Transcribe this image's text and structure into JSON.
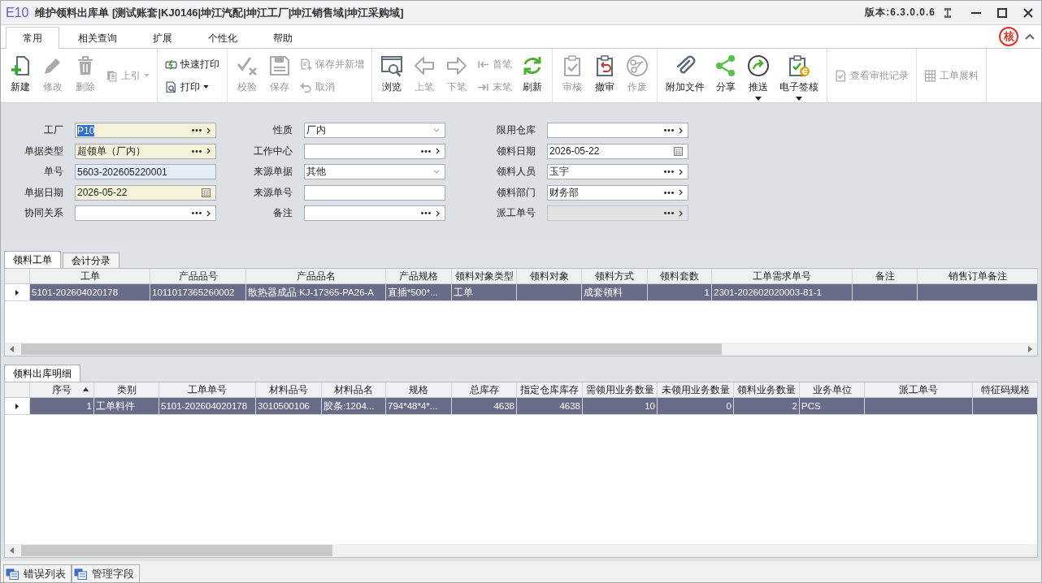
{
  "window": {
    "logo": "E10",
    "title": "维护领料出库单 [测试账套|KJ0146|坤江汽配|坤江工厂|坤江销售域|坤江采购域]",
    "version": "版本:6.3.0.0.6"
  },
  "ribbon_tabs": [
    {
      "label": "常用",
      "selected": true
    },
    {
      "label": "相关查询",
      "selected": false
    },
    {
      "label": "扩展",
      "selected": false
    },
    {
      "label": "个性化",
      "selected": false
    },
    {
      "label": "帮助",
      "selected": false
    }
  ],
  "stamp": "核",
  "toolbar": {
    "groups": [
      {
        "items": [
          {
            "kind": "large",
            "label": "新建",
            "disabled": false,
            "dropdown": false
          },
          {
            "kind": "large",
            "label": "修改",
            "disabled": true,
            "dropdown": false
          },
          {
            "kind": "large",
            "label": "删除",
            "disabled": true,
            "dropdown": false
          },
          {
            "kind": "inline",
            "label": "上引",
            "disabled": true,
            "dropdown": true
          }
        ]
      },
      {
        "items": [
          {
            "kind": "stack",
            "items": [
              {
                "label": "快速打印",
                "disabled": false,
                "dropdown": false
              },
              {
                "label": "打印",
                "disabled": false,
                "dropdown": true
              }
            ]
          }
        ]
      },
      {
        "items": [
          {
            "kind": "large",
            "label": "校验",
            "disabled": true,
            "dropdown": false
          },
          {
            "kind": "large",
            "label": "保存",
            "disabled": true,
            "dropdown": false
          },
          {
            "kind": "stack",
            "items": [
              {
                "label": "保存并新增",
                "disabled": true,
                "dropdown": false
              },
              {
                "label": "取消",
                "disabled": true,
                "dropdown": false
              }
            ]
          }
        ]
      },
      {
        "items": [
          {
            "kind": "large",
            "label": "浏览",
            "disabled": false,
            "dropdown": false
          },
          {
            "kind": "large",
            "label": "上笔",
            "disabled": true,
            "dropdown": false
          },
          {
            "kind": "large",
            "label": "下笔",
            "disabled": true,
            "dropdown": false
          },
          {
            "kind": "stack",
            "items": [
              {
                "label": "首笔",
                "disabled": true,
                "dropdown": false
              },
              {
                "label": "末笔",
                "disabled": true,
                "dropdown": false
              }
            ]
          },
          {
            "kind": "large",
            "label": "刷新",
            "disabled": false,
            "dropdown": false
          }
        ]
      },
      {
        "items": [
          {
            "kind": "large",
            "label": "审核",
            "disabled": true,
            "dropdown": false
          },
          {
            "kind": "large",
            "label": "撤审",
            "disabled": false,
            "dropdown": false
          },
          {
            "kind": "large",
            "label": "作废",
            "disabled": true,
            "dropdown": false
          }
        ]
      },
      {
        "items": [
          {
            "kind": "large",
            "label": "附加文件",
            "disabled": false,
            "dropdown": false
          },
          {
            "kind": "large",
            "label": "分享",
            "disabled": false,
            "dropdown": false
          },
          {
            "kind": "large",
            "label": "推送",
            "disabled": false,
            "dropdown": true
          },
          {
            "kind": "large",
            "label": "电子签核",
            "disabled": false,
            "dropdown": true
          }
        ]
      },
      {
        "items": [
          {
            "kind": "inline",
            "label": "查看审批记录",
            "disabled": true,
            "dropdown": false
          }
        ]
      },
      {
        "items": [
          {
            "kind": "inline",
            "label": "工单展料",
            "disabled": true,
            "dropdown": false
          }
        ]
      }
    ]
  },
  "form": {
    "columns": [
      {
        "fields": [
          {
            "label": "工厂",
            "kind": "lookup",
            "required": true,
            "readonly": false,
            "disabled": false,
            "value": "P10",
            "text_selected": true
          },
          {
            "label": "单据类型",
            "kind": "lookup",
            "required": true,
            "readonly": false,
            "disabled": false,
            "value": "超领单（厂内）",
            "text_selected": false
          },
          {
            "label": "单号",
            "kind": "text",
            "required": false,
            "readonly": true,
            "disabled": false,
            "value": "5603-202605220001",
            "text_selected": false
          },
          {
            "label": "单据日期",
            "kind": "date",
            "required": true,
            "readonly": false,
            "disabled": false,
            "value": "2026-05-22",
            "text_selected": false
          },
          {
            "label": "协同关系",
            "kind": "lookup",
            "required": false,
            "readonly": false,
            "disabled": false
          }
        ]
      },
      {
        "fields": [
          {
            "label": "性质",
            "kind": "select",
            "required": false,
            "readonly": false,
            "disabled": false,
            "value": "厂内",
            "text_selected": false
          },
          {
            "label": "工作中心",
            "kind": "lookup",
            "required": false,
            "readonly": false,
            "disabled": false
          },
          {
            "label": "来源单据",
            "kind": "select",
            "required": false,
            "readonly": false,
            "disabled": false,
            "value": "其他",
            "text_selected": false
          },
          {
            "label": "来源单号",
            "kind": "text",
            "required": false,
            "readonly": false,
            "disabled": false
          },
          {
            "label": "备注",
            "kind": "lookup",
            "required": false,
            "readonly": false,
            "disabled": false
          }
        ]
      },
      {
        "fields": [
          {
            "label": "限用仓库",
            "kind": "lookup",
            "required": false,
            "readonly": false,
            "disabled": false
          },
          {
            "label": "领料日期",
            "kind": "date",
            "required": false,
            "readonly": false,
            "disabled": false,
            "value": "2026-05-22",
            "text_selected": false
          },
          {
            "label": "领料人员",
            "kind": "lookup",
            "required": false,
            "readonly": false,
            "disabled": false,
            "value": "玉宇",
            "text_selected": false
          },
          {
            "label": "领料部门",
            "kind": "lookup",
            "required": false,
            "readonly": false,
            "disabled": false,
            "value": "财务部",
            "text_selected": false
          },
          {
            "label": "派工单号",
            "kind": "lookup",
            "required": false,
            "readonly": false,
            "disabled": true
          }
        ]
      }
    ]
  },
  "grids": [
    {
      "tabs": [
        {
          "label": "领料工单",
          "selected": true
        },
        {
          "label": "会计分录",
          "selected": false
        }
      ],
      "columns": [
        {
          "label": "工单",
          "numeric": false
        },
        {
          "label": "产品品号",
          "numeric": false
        },
        {
          "label": "产品品名",
          "numeric": false
        },
        {
          "label": "产品规格",
          "numeric": false
        },
        {
          "label": "领料对象类型",
          "numeric": false
        },
        {
          "label": "领料对象"
        },
        {
          "label": "领料方式",
          "numeric": false
        },
        {
          "label": "领料套数",
          "numeric": true
        },
        {
          "label": "工单需求单号",
          "numeric": false
        },
        {
          "label": "备注"
        },
        {
          "label": "销售订单备注"
        }
      ],
      "rows": [
        {
          "selected": true,
          "cells": [
            "5101-202604020178",
            "1011017365260002",
            "散热器成品:KJ-17365-PA26-A",
            "直插*500*...",
            "工单",
            "",
            "成套领料",
            "1",
            "2301-202602020003-81-1",
            "",
            ""
          ]
        }
      ]
    },
    {
      "tabs": [
        {
          "label": "领料出库明细",
          "selected": true
        }
      ],
      "columns": [
        {
          "label": "序号",
          "numeric": true,
          "sorted": true
        },
        {
          "label": "类别",
          "numeric": false,
          "sorted": false
        },
        {
          "label": "工单单号",
          "numeric": false,
          "sorted": false
        },
        {
          "label": "材料品号",
          "numeric": false,
          "sorted": false
        },
        {
          "label": "材料品名",
          "numeric": false,
          "sorted": false
        },
        {
          "label": "规格",
          "numeric": false,
          "sorted": false
        },
        {
          "label": "总库存",
          "numeric": true,
          "sorted": false
        },
        {
          "label": "指定仓库库存",
          "numeric": true,
          "sorted": false
        },
        {
          "label": "需领用业务数量",
          "numeric": true,
          "sorted": false
        },
        {
          "label": "未领用业务数量",
          "numeric": true,
          "sorted": false
        },
        {
          "label": "领料业务数量",
          "numeric": true,
          "sorted": false
        },
        {
          "label": "业务单位",
          "numeric": false,
          "sorted": false
        },
        {
          "label": "派工单号",
          "sorted": false
        },
        {
          "label": "特征码规格",
          "sorted": false
        }
      ],
      "rows": [
        {
          "selected": true,
          "cells": [
            "1",
            "工单料件",
            "5101-202604020178",
            "3010500106",
            "胶条:1204...",
            "794*48*4*...",
            "4638",
            "4638",
            "10",
            "0",
            "2",
            "PCS",
            "",
            ""
          ]
        }
      ]
    }
  ],
  "bottom_tabs": [
    {
      "label": "错误列表"
    },
    {
      "label": "管理字段"
    }
  ]
}
